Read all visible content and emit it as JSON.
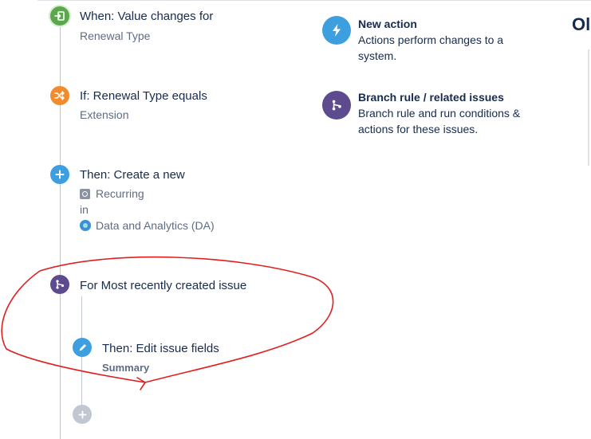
{
  "rule": {
    "trigger": {
      "title": "When: Value changes for",
      "subtitle": "Renewal Type",
      "icon": "trigger-icon"
    },
    "condition": {
      "title": "If: Renewal Type equals",
      "subtitle": "Extension",
      "icon": "shuffle-icon"
    },
    "create_action": {
      "title": "Then: Create a new",
      "issue_type": "Recurring",
      "in_label": "in",
      "project": "Data and Analytics (DA)",
      "icon": "plus-icon"
    },
    "branch": {
      "title": "For Most recently created issue",
      "icon": "branch-icon"
    },
    "edit_action": {
      "title": "Then: Edit issue fields",
      "subtitle": "Summary",
      "icon": "pencil-icon"
    },
    "add_component": {
      "icon": "plus-icon"
    }
  },
  "panel": {
    "heading_cut": "Ol",
    "options": [
      {
        "title": "New action",
        "description": "Actions perform changes to a system.",
        "icon": "lightning-icon"
      },
      {
        "title": "Branch rule / related issues",
        "description": "Branch rule and run conditions & actions for these issues.",
        "icon": "branch-icon"
      }
    ]
  },
  "colors": {
    "trigger": "#5aa84b",
    "condition": "#f18b2c",
    "action": "#3d9ee0",
    "branch": "#5e4a8e",
    "add": "#c1c7d0",
    "annotation": "#e02020"
  }
}
